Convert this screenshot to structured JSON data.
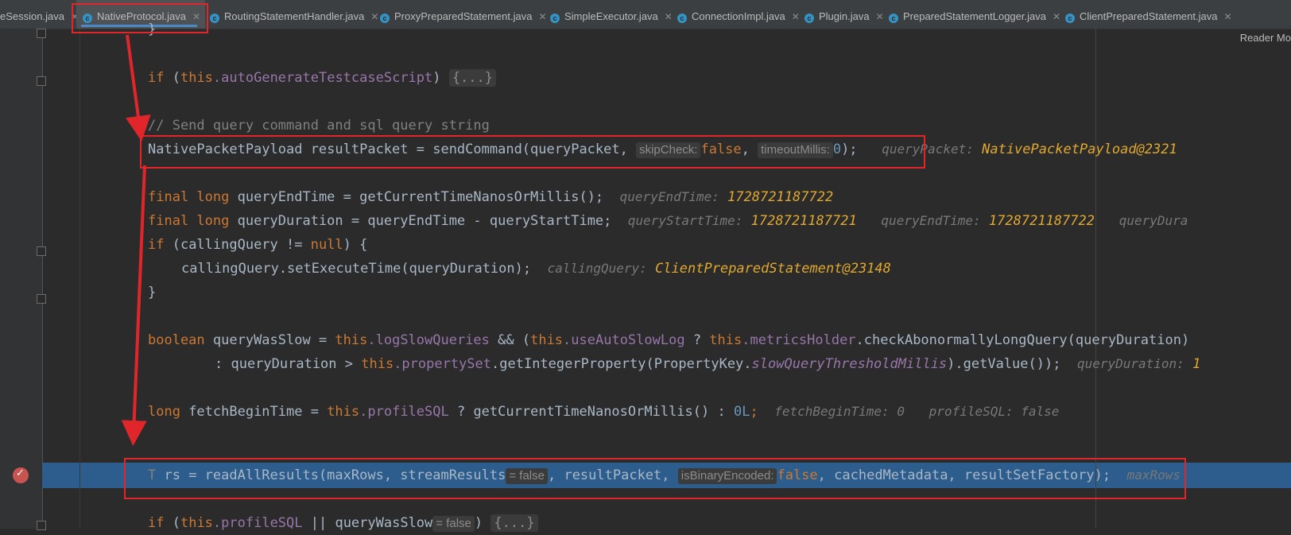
{
  "tabs": [
    {
      "label": "eSession.java",
      "icon": "class-icon"
    },
    {
      "label": "NativeProtocol.java",
      "icon": "class-icon",
      "active": true
    },
    {
      "label": "RoutingStatementHandler.java",
      "icon": "class-icon"
    },
    {
      "label": "ProxyPreparedStatement.java",
      "icon": "class-icon"
    },
    {
      "label": "SimpleExecutor.java",
      "icon": "class-icon"
    },
    {
      "label": "ConnectionImpl.java",
      "icon": "class-icon"
    },
    {
      "label": "Plugin.java",
      "icon": "class-icon"
    },
    {
      "label": "PreparedStatementLogger.java",
      "icon": "class-icon"
    },
    {
      "label": "ClientPreparedStatement.java",
      "icon": "class-icon"
    }
  ],
  "reader_mode": "Reader Mo",
  "code": {
    "l0": "}",
    "l1_kw": "if",
    "l1_a": " (",
    "l1_this": "this",
    "l1_fld": ".autoGenerateTestcaseScript",
    "l1_b": ") ",
    "l1_fold": "{...}",
    "l2": "// Send query command and sql query string",
    "l3_a": "NativePacketPayload resultPacket = sendCommand(queryPacket, ",
    "l3_hint1": "skipCheck:",
    "l3_v1": "false",
    "l3_c": ", ",
    "l3_hint2": "timeoutMillis:",
    "l3_v2": "0",
    "l3_d": ");",
    "l3_inl_k": "queryPacket:",
    "l3_inl_v": "NativePacketPayload@2321",
    "l4_kw": "final long",
    "l4_a": " queryEndTime = getCurrentTimeNanosOrMillis();",
    "l4_inl_k": "queryEndTime:",
    "l4_inl_v": "1728721187722",
    "l5_kw": "final long",
    "l5_a": " queryDuration = queryEndTime - queryStartTime;",
    "l5_inl_k1": "queryStartTime:",
    "l5_inl_v1": "1728721187721",
    "l5_inl_k2": "queryEndTime:",
    "l5_inl_v2": "1728721187722",
    "l5_inl_k3": "queryDura",
    "l6_kw": "if",
    "l6_a": " (callingQuery != ",
    "l6_null": "null",
    "l6_b": ") {",
    "l7_a": "callingQuery.setExecuteTime(queryDuration);",
    "l7_inl_k": "callingQuery:",
    "l7_inl_v": "ClientPreparedStatement@23148",
    "l8": "}",
    "l9_kw": "boolean",
    "l9_a": " queryWasSlow = ",
    "l9_this1": "this",
    "l9_f1": ".logSlowQueries",
    "l9_b": " && (",
    "l9_this2": "this",
    "l9_f2": ".useAutoSlowLog",
    "l9_c": " ? ",
    "l9_this3": "this",
    "l9_f3": ".metricsHolder",
    "l9_d": ".checkAbonormallyLongQuery(queryDuration)",
    "l10_a": ": queryDuration > ",
    "l10_this": "this",
    "l10_f": ".propertySet",
    "l10_b": ".getIntegerProperty(PropertyKey.",
    "l10_it": "slowQueryThresholdMillis",
    "l10_c": ").getValue());",
    "l10_inl_k": "queryDuration:",
    "l10_inl_v": "1",
    "l11_kw": "long",
    "l11_a": " fetchBeginTime = ",
    "l11_this": "this",
    "l11_f": ".profileSQL",
    "l11_b": " ? getCurrentTimeNanosOrMillis() : ",
    "l11_num": "0L",
    "l11_c": ";",
    "l11_inl1": "fetchBeginTime: 0",
    "l11_inl2": "profileSQL: false",
    "l12_t": "T",
    "l12_a": " rs = readAllResults(maxRows, streamResults",
    "l12_ph1": "= false",
    "l12_b": ", resultPacket, ",
    "l12_hint": "isBinaryEncoded:",
    "l12_v": "false",
    "l12_c": ", cachedMetadata, resultSetFactory);",
    "l12_inl": "maxRows",
    "l13_kw": "if",
    "l13_a": " (",
    "l13_this": "this",
    "l13_f": ".profileSQL",
    "l13_b": " || queryWasSlow",
    "l13_ph": "= false",
    "l13_c": ") ",
    "l13_fold": "{...}"
  },
  "colors": {
    "annotation": "#e0262a",
    "selection": "#2d5d8c",
    "accent": "#4a88c7"
  }
}
